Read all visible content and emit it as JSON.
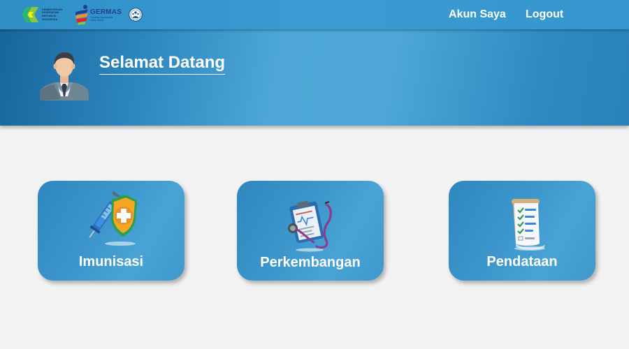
{
  "header": {
    "logos": {
      "kemkes_text": "KEMENTERIAN KESEHATAN REPUBLIK INDONESIA",
      "germas_title": "GERMAS",
      "germas_sub": "Gerakan Masyarakat Hidup Sehat"
    },
    "nav": {
      "account": "Akun Saya",
      "logout": "Logout"
    }
  },
  "banner": {
    "welcome": "Selamat Datang"
  },
  "cards": [
    {
      "label": "Imunisasi",
      "icon": "vaccine-shield-icon"
    },
    {
      "label": "Perkembangan",
      "icon": "clipboard-stethoscope-icon"
    },
    {
      "label": "Pendataan",
      "icon": "checklist-scroll-icon"
    }
  ],
  "colors": {
    "topbar": "#3596cd",
    "banner_dark": "#17669c",
    "banner_light": "#4fa8d9",
    "card": "#3d97cc",
    "background": "#f2f2f2"
  }
}
